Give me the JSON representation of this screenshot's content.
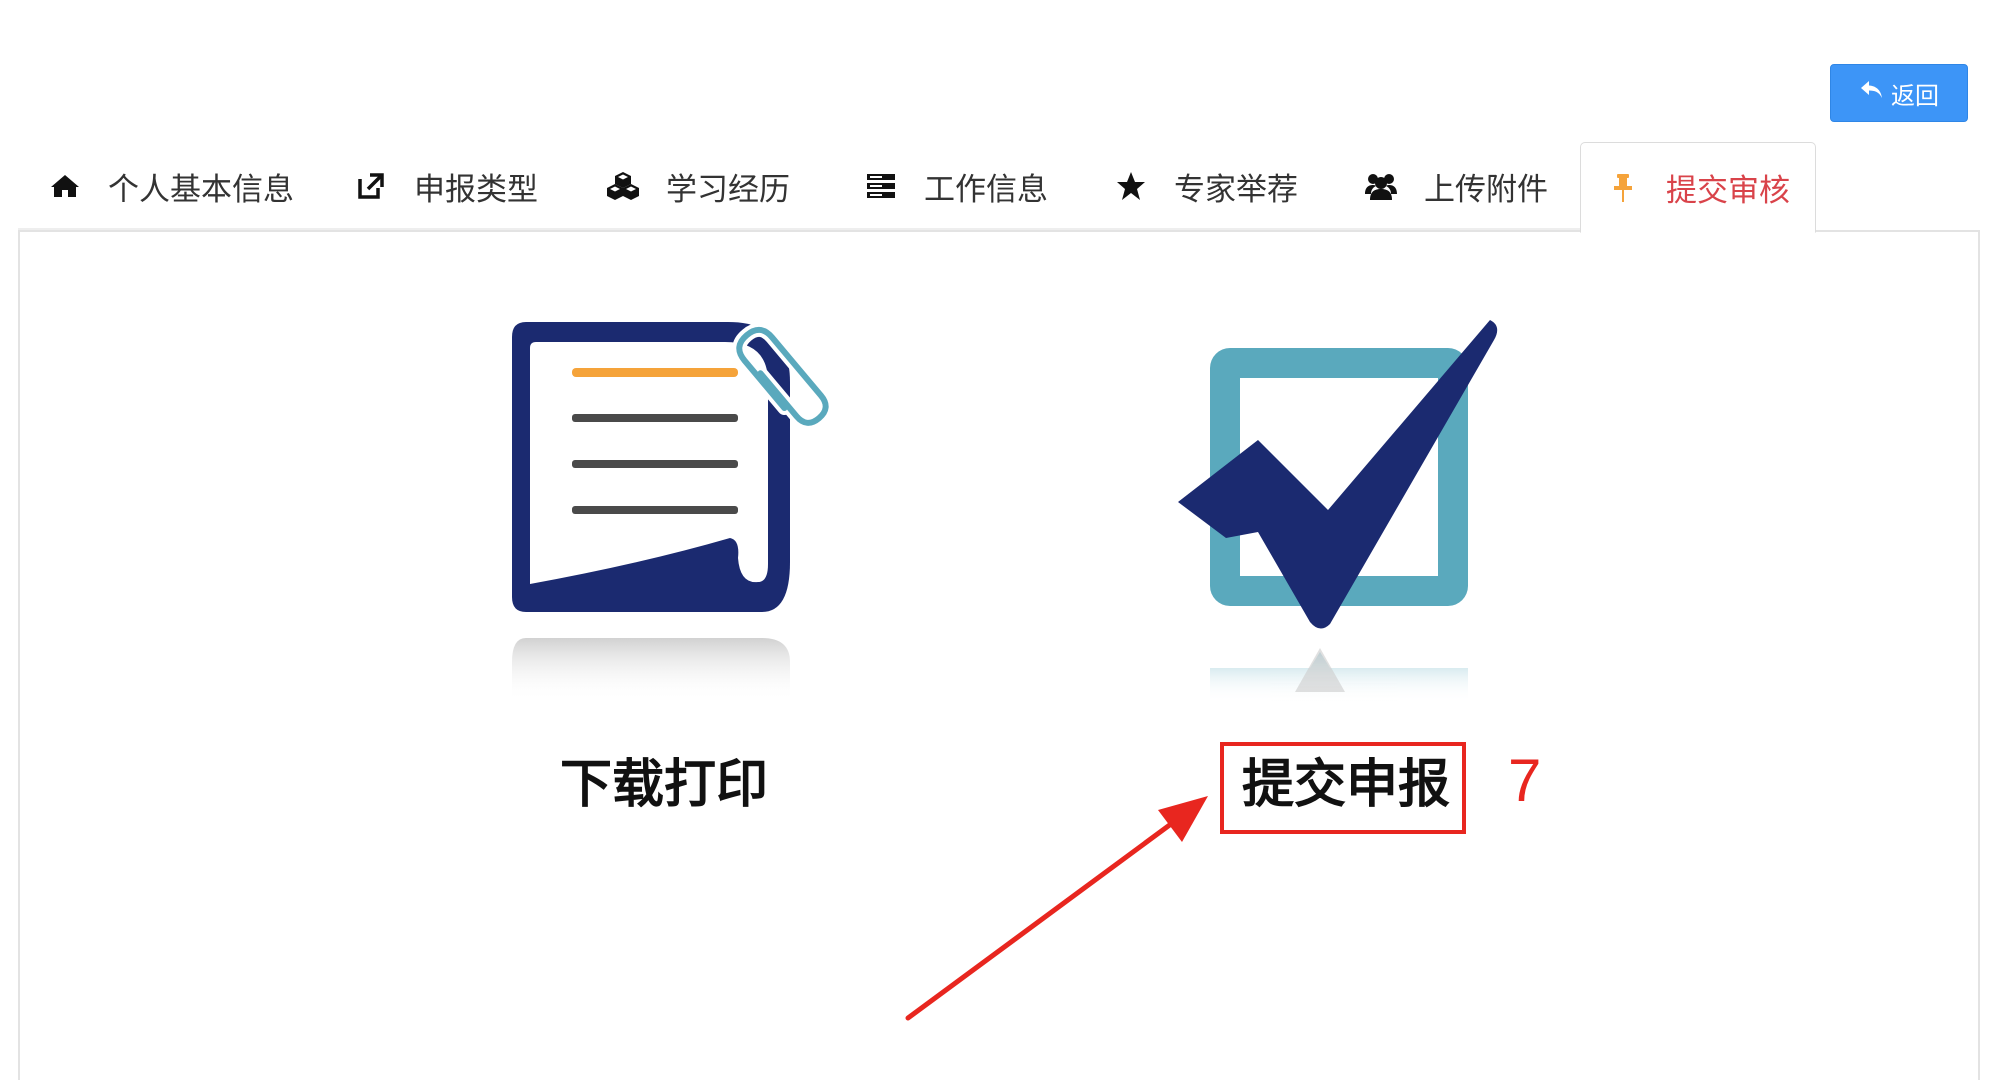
{
  "header": {
    "back_button_label": "返回"
  },
  "tabs": [
    {
      "label": "个人基本信息",
      "icon": "home-icon"
    },
    {
      "label": "申报类型",
      "icon": "external-link-icon"
    },
    {
      "label": "学习经历",
      "icon": "cubes-icon"
    },
    {
      "label": "工作信息",
      "icon": "server-icon"
    },
    {
      "label": "专家举荐",
      "icon": "star-icon"
    },
    {
      "label": "上传附件",
      "icon": "users-icon"
    },
    {
      "label": "提交审核",
      "icon": "pin-icon",
      "active": true
    }
  ],
  "options": {
    "download": {
      "label": "下载打印",
      "icon": "document-paperclip-icon"
    },
    "submit": {
      "label": "提交申报",
      "icon": "checkbox-check-icon"
    }
  },
  "annotation": {
    "step_number": "7"
  },
  "colors": {
    "accent_blue": "#3d95f7",
    "active_tab_text": "#d9434a",
    "navy": "#1b2a70",
    "teal": "#5aa9bd",
    "orange": "#f5a33a",
    "annotation_red": "#e8261f"
  }
}
